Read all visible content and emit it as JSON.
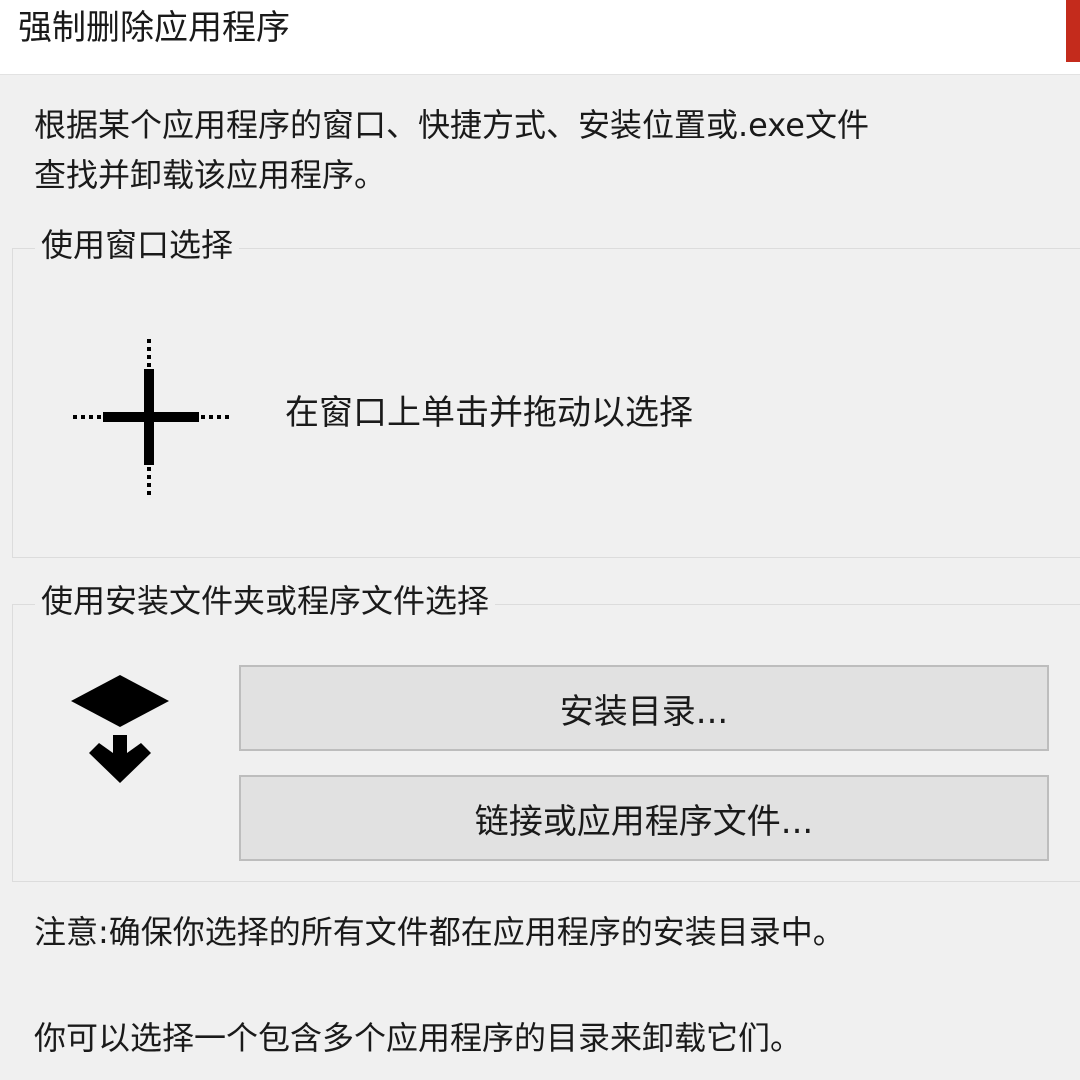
{
  "window": {
    "title": "强制删除应用程序"
  },
  "description": {
    "line1": "根据某个应用程序的窗口、快捷方式、安装位置或.exe文件",
    "line2": "查找并卸载该应用程序。"
  },
  "window_select": {
    "legend": "使用窗口选择",
    "icon": "crosshair-icon",
    "instruction": "在窗口上单击并拖动以选择"
  },
  "file_select": {
    "legend": "使用安装文件夹或程序文件选择",
    "icon": "install-arrow-icon",
    "install_dir_button": "安装目录...",
    "link_or_file_button": "链接或应用程序文件..."
  },
  "notes": {
    "note1": "注意:确保你选择的所有文件都在应用程序的安装目录中。",
    "note2": "你可以选择一个包含多个应用程序的目录来卸载它们。"
  }
}
